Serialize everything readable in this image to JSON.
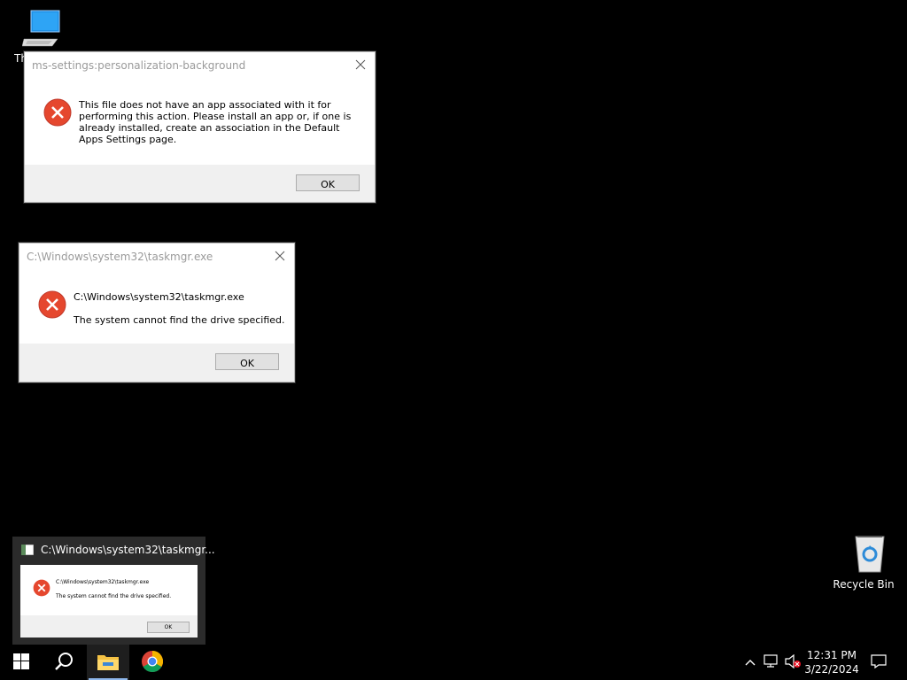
{
  "desktop": {
    "icons": [
      {
        "label": "This PC",
        "icon": "computer-icon"
      },
      {
        "label": "Recycle Bin",
        "icon": "recycle-bin-icon"
      }
    ]
  },
  "dialog_personalization": {
    "title": "ms-settings:personalization-background",
    "message": "This file does not have an app associated with it for performing this action. Please install an app or, if one is already installed, create an association in the Default Apps Settings page.",
    "ok_label": "OK"
  },
  "dialog_taskmgr": {
    "title": "C:\\Windows\\system32\\taskmgr.exe",
    "path": "C:\\Windows\\system32\\taskmgr.exe",
    "message": "The system cannot find the drive specified.",
    "ok_label": "OK"
  },
  "taskbar_preview": {
    "title": "C:\\Windows\\system32\\taskmgr...",
    "path": "C:\\Windows\\system32\\taskmgr.exe",
    "message": "The system cannot find the drive specified.",
    "ok_label": "OK"
  },
  "taskbar": {
    "buttons": [
      "start-icon",
      "search-icon",
      "file-explorer-icon",
      "chrome-icon"
    ],
    "tray_icons": [
      "chevron-up-icon",
      "network-icon",
      "volume-muted-icon",
      "notifications-icon"
    ],
    "time": "12:31 PM",
    "date": "3/22/2024"
  },
  "colors": {
    "desktop_bg": "#000000",
    "error_red": "#e81123",
    "dialog_footer": "#f0f0f0",
    "taskbar_accent": "#8fb8ec"
  }
}
